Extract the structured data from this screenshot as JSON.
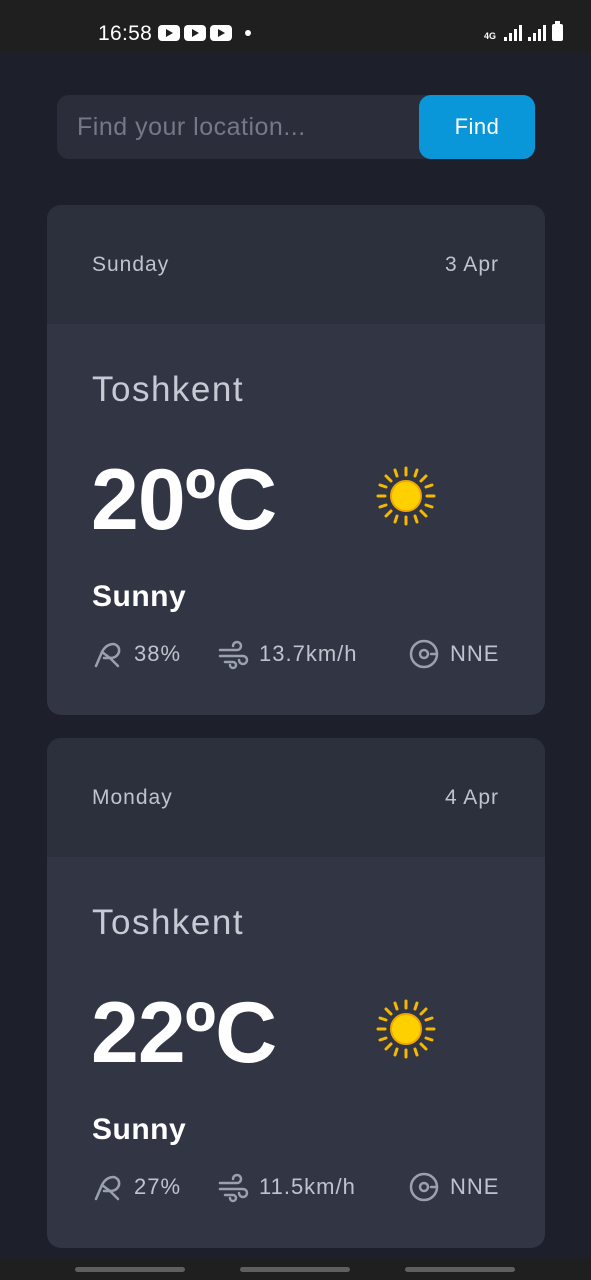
{
  "status_bar": {
    "time": "16:58",
    "network": "4G",
    "notification_icons": [
      "youtube-icon",
      "youtube-icon",
      "youtube-icon"
    ]
  },
  "search": {
    "placeholder": "Find your location...",
    "value": "",
    "button_label": "Find"
  },
  "colors": {
    "background": "#1d202b",
    "card": "#323644",
    "card_header": "#2c303c",
    "accent": "#0a97d9",
    "sun": "#f5b800"
  },
  "forecast": [
    {
      "day": "Sunday",
      "date": "3 Apr",
      "city": "Toshkent",
      "temperature": "20",
      "unit": "C",
      "degree_symbol": "º",
      "condition": "Sunny",
      "condition_icon": "sun-icon",
      "humidity": "38%",
      "wind_speed": "13.7km/h",
      "wind_direction": "NNE"
    },
    {
      "day": "Monday",
      "date": "4 Apr",
      "city": "Toshkent",
      "temperature": "22",
      "unit": "C",
      "degree_symbol": "º",
      "condition": "Sunny",
      "condition_icon": "sun-icon",
      "humidity": "27%",
      "wind_speed": "11.5km/h",
      "wind_direction": "NNE"
    }
  ]
}
